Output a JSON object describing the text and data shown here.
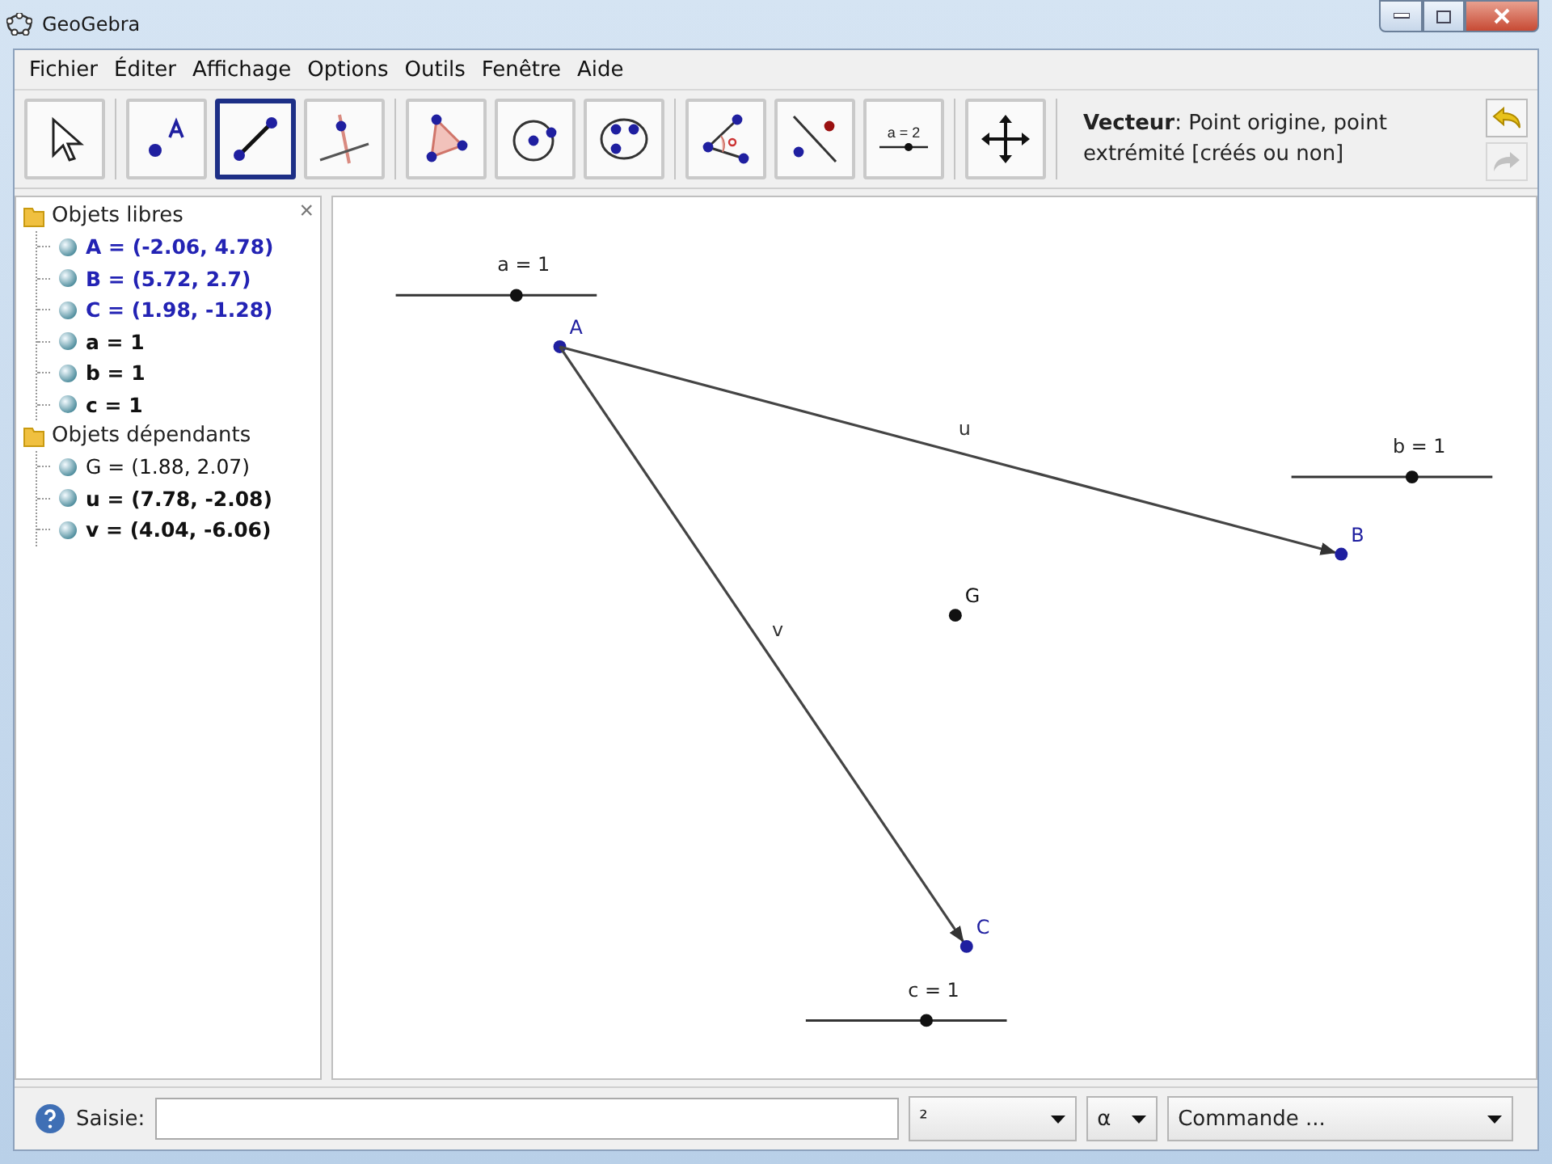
{
  "window": {
    "title": "GeoGebra"
  },
  "menu": [
    "Fichier",
    "Éditer",
    "Affichage",
    "Options",
    "Outils",
    "Fenêtre",
    "Aide"
  ],
  "tools": [
    {
      "selected": false
    },
    {
      "selected": false
    },
    {
      "selected": true
    },
    {
      "selected": false
    },
    {
      "selected": false
    },
    {
      "selected": false
    },
    {
      "selected": false
    },
    {
      "selected": false
    },
    {
      "selected": false
    },
    {
      "selected": false,
      "label": "a = 2"
    },
    {
      "selected": false
    }
  ],
  "tool_help": "**Vecteur**: Point origine, point extrémité [créés ou non]",
  "undo": {
    "disabled": false
  },
  "redo": {
    "disabled": true
  },
  "algebra": {
    "close": "×",
    "folders": [
      {
        "label": "Objets libres",
        "children": [
          {
            "text": "A = (-2.06, 4.78)",
            "color": "#2323b4",
            "bold": true
          },
          {
            "text": "B = (5.72, 2.7)",
            "color": "#2323b4",
            "bold": true
          },
          {
            "text": "C = (1.98, -1.28)",
            "color": "#2323b4",
            "bold": true
          },
          {
            "text": "a = 1",
            "color": "#111111",
            "bold": true
          },
          {
            "text": "b = 1",
            "color": "#111111",
            "bold": true
          },
          {
            "text": "c = 1",
            "color": "#111111",
            "bold": true
          }
        ]
      },
      {
        "label": "Objets dépendants",
        "children": [
          {
            "text": "G = (1.88, 2.07)",
            "color": "#111111",
            "bold": false
          },
          {
            "text": "u = (7.78, -2.08)",
            "color": "#111111",
            "bold": true
          },
          {
            "text": "v = (4.04, -6.06)",
            "color": "#111111",
            "bold": true
          }
        ]
      }
    ]
  },
  "canvas": {
    "sliders": [
      {
        "label": "a = 1",
        "level": 0.6
      },
      {
        "label": "b = 1",
        "level": 0.6
      },
      {
        "label": "c = 1",
        "level": 0.6
      }
    ],
    "points": [
      {
        "label": "A",
        "color": "#1f1fa0"
      },
      {
        "label": "B",
        "color": "#1f1fa0"
      },
      {
        "label": "C",
        "color": "#1f1fa0"
      },
      {
        "label": "G",
        "color": "#111111"
      }
    ],
    "vectors": [
      {
        "label": "u"
      },
      {
        "label": "v"
      }
    ]
  },
  "input_bar": {
    "label": "Saisie:",
    "symbols": "²",
    "greek": "α",
    "command": "Commande ..."
  }
}
